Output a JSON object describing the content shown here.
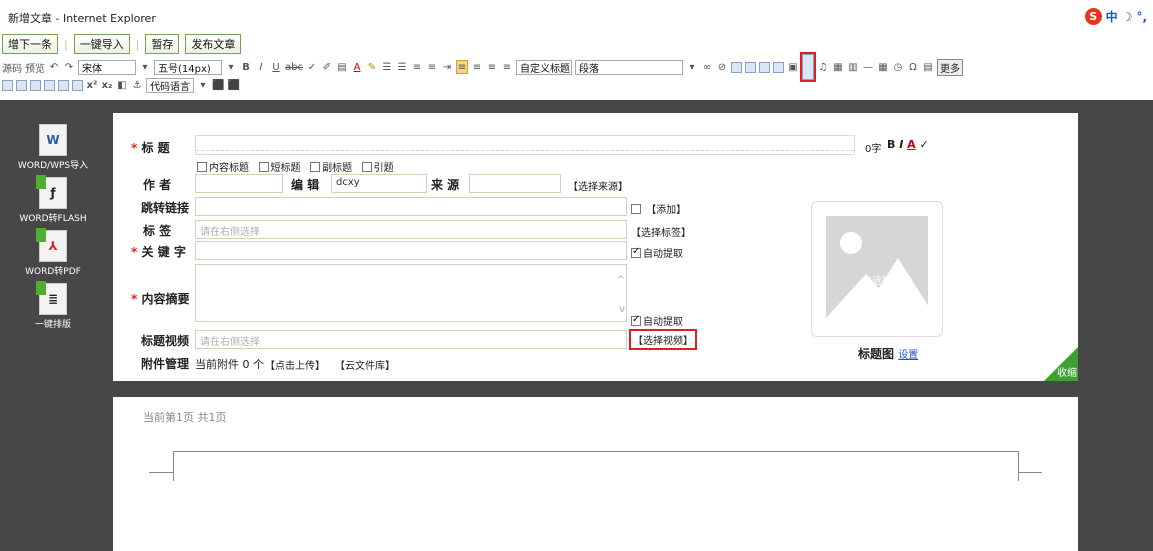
{
  "window": {
    "title": "新增文章 - Internet Explorer"
  },
  "top_actions": [
    "增下一条",
    "一键导入",
    "暂存",
    "发布文章"
  ],
  "toolbar": {
    "source": "源码",
    "preview": "预览",
    "font_family": "宋体",
    "font_size": "五号(14px)",
    "custom_heading": "自定义标题",
    "paragraph": "段落",
    "more": "更多",
    "code_language": "代码语言",
    "superscript": "x²",
    "subscript": "x₂"
  },
  "sidebar": [
    {
      "label": "WORD/WPS导入",
      "icon": "word-icon"
    },
    {
      "label": "WORD转FLASH",
      "icon": "flash-icon"
    },
    {
      "label": "WORD转PDF",
      "icon": "pdf-icon"
    },
    {
      "label": "一键排版",
      "icon": "layout-icon"
    }
  ],
  "form": {
    "title_label": "标 题",
    "char_count": "0字",
    "title_options": [
      "内容标题",
      "短标题",
      "副标题",
      "引题"
    ],
    "author_label": "作 者",
    "editor_label": "编 辑",
    "editor_value": "dcxy",
    "source_label": "来 源",
    "source_link": "【选择来源】",
    "jump_label": "跳转链接",
    "jump_add": "【添加】",
    "tags_label": "标 签",
    "tags_placeholder": "请在右侧选择",
    "tags_link": "【选择标签】",
    "keyword_label": "关 键 字",
    "auto_extract": "自动提取",
    "summary_label": "内容摘要",
    "summary_auto": "自动提取",
    "video_label": "标题视频",
    "video_placeholder": "请在右侧选择",
    "video_link": "【选择视频】",
    "attach_label": "附件管理",
    "attach_current": "当前附件",
    "attach_count": "0",
    "attach_unit": "个",
    "upload_link": "【点击上传】",
    "cloud_link": "【云文件库】",
    "thumb_text": "未选择",
    "thumb_label": "标题图",
    "thumb_set": "设置",
    "collapse": "收缩"
  },
  "document": {
    "page_info": "当前第1页 共1页"
  },
  "colors": {
    "accent_green": "#3ca033",
    "highlight_red": "#e02020",
    "link_orange": "#e07e1a",
    "workspace": "#474747"
  }
}
